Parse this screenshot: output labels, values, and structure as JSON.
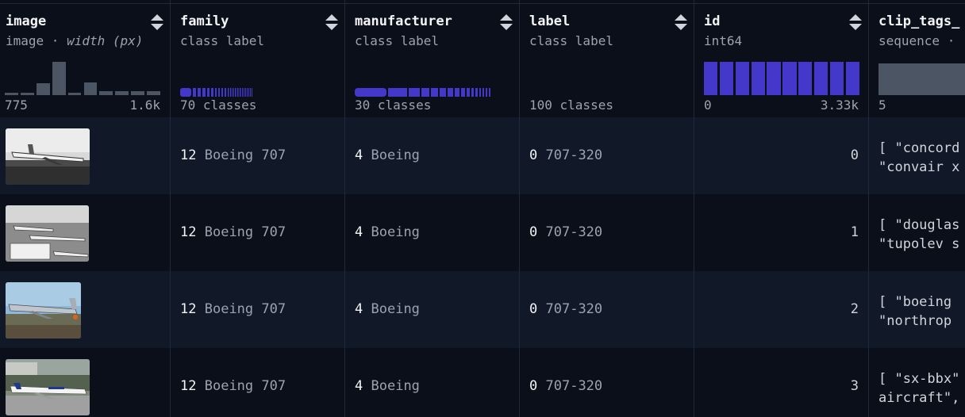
{
  "columns": {
    "image": {
      "name": "image",
      "type_prefix": "image · ",
      "type_italic": "width (px)",
      "min": "775",
      "max": "1.6k"
    },
    "family": {
      "name": "family",
      "type": "class label",
      "summary": "70 classes"
    },
    "manufacturer": {
      "name": "manufacturer",
      "type": "class label",
      "summary": "30 classes"
    },
    "label": {
      "name": "label",
      "type": "class label",
      "summary": "100 classes"
    },
    "id": {
      "name": "id",
      "type": "int64",
      "min": "0",
      "max": "3.33k"
    },
    "clip_tags": {
      "name": "clip_tags_",
      "type": "sequence · ",
      "summary": "5"
    }
  },
  "image_hist": [
    0.05,
    0.05,
    0.3,
    0.85,
    0.05,
    0.32,
    0.1,
    0.1,
    0.1,
    0.1
  ],
  "id_hist": [
    0.85,
    0.85,
    0.85,
    0.85,
    0.85,
    0.85,
    0.85,
    0.85,
    0.85,
    0.85
  ],
  "rows": [
    {
      "family_num": "12",
      "family_label": "Boeing 707",
      "man_num": "4",
      "man_label": "Boeing",
      "label_num": "0",
      "label_label": "707-320",
      "id": "0",
      "clip_line1": "[ \"concord",
      "clip_line2": "\"convair x"
    },
    {
      "family_num": "12",
      "family_label": "Boeing 707",
      "man_num": "4",
      "man_label": "Boeing",
      "label_num": "0",
      "label_label": "707-320",
      "id": "1",
      "clip_line1": "[ \"douglas",
      "clip_line2": "\"tupolev s"
    },
    {
      "family_num": "12",
      "family_label": "Boeing 707",
      "man_num": "4",
      "man_label": "Boeing",
      "label_num": "0",
      "label_label": "707-320",
      "id": "2",
      "clip_line1": "[ \"boeing ",
      "clip_line2": "\"northrop "
    },
    {
      "family_num": "12",
      "family_label": "Boeing 707",
      "man_num": "4",
      "man_label": "Boeing",
      "label_num": "0",
      "label_label": "707-320",
      "id": "3",
      "clip_line1": "[ \"sx-bbx\"",
      "clip_line2": "aircraft\","
    }
  ],
  "colors": {
    "accent": "#4338ca",
    "accent_light": "#6366f1",
    "bg": "#0b0f19",
    "row_alt": "#111827"
  }
}
